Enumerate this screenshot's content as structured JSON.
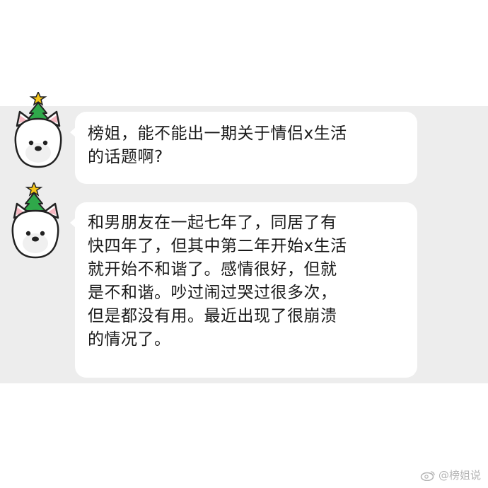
{
  "messages": [
    {
      "text": "榜姐，能不能出一期关于情侣x生活\n的话题啊?"
    },
    {
      "text": "和男朋友在一起七年了，同居了有\n快四年了，但其中第二年开始x生活\n就开始不和谐了。感情很好，但就\n是不和谐。吵过闹过哭过很多次，\n但是都没有用。最近出现了很崩溃\n的情况了。"
    }
  ],
  "watermark": {
    "text": "@榜姐说",
    "icon": "weibo-icon"
  },
  "colors": {
    "panel_bg": "#ededed",
    "bubble_bg": "#ffffff",
    "text": "#1a1a1a",
    "hat_green": "#2fa84a",
    "star_yellow": "#f5c518"
  }
}
